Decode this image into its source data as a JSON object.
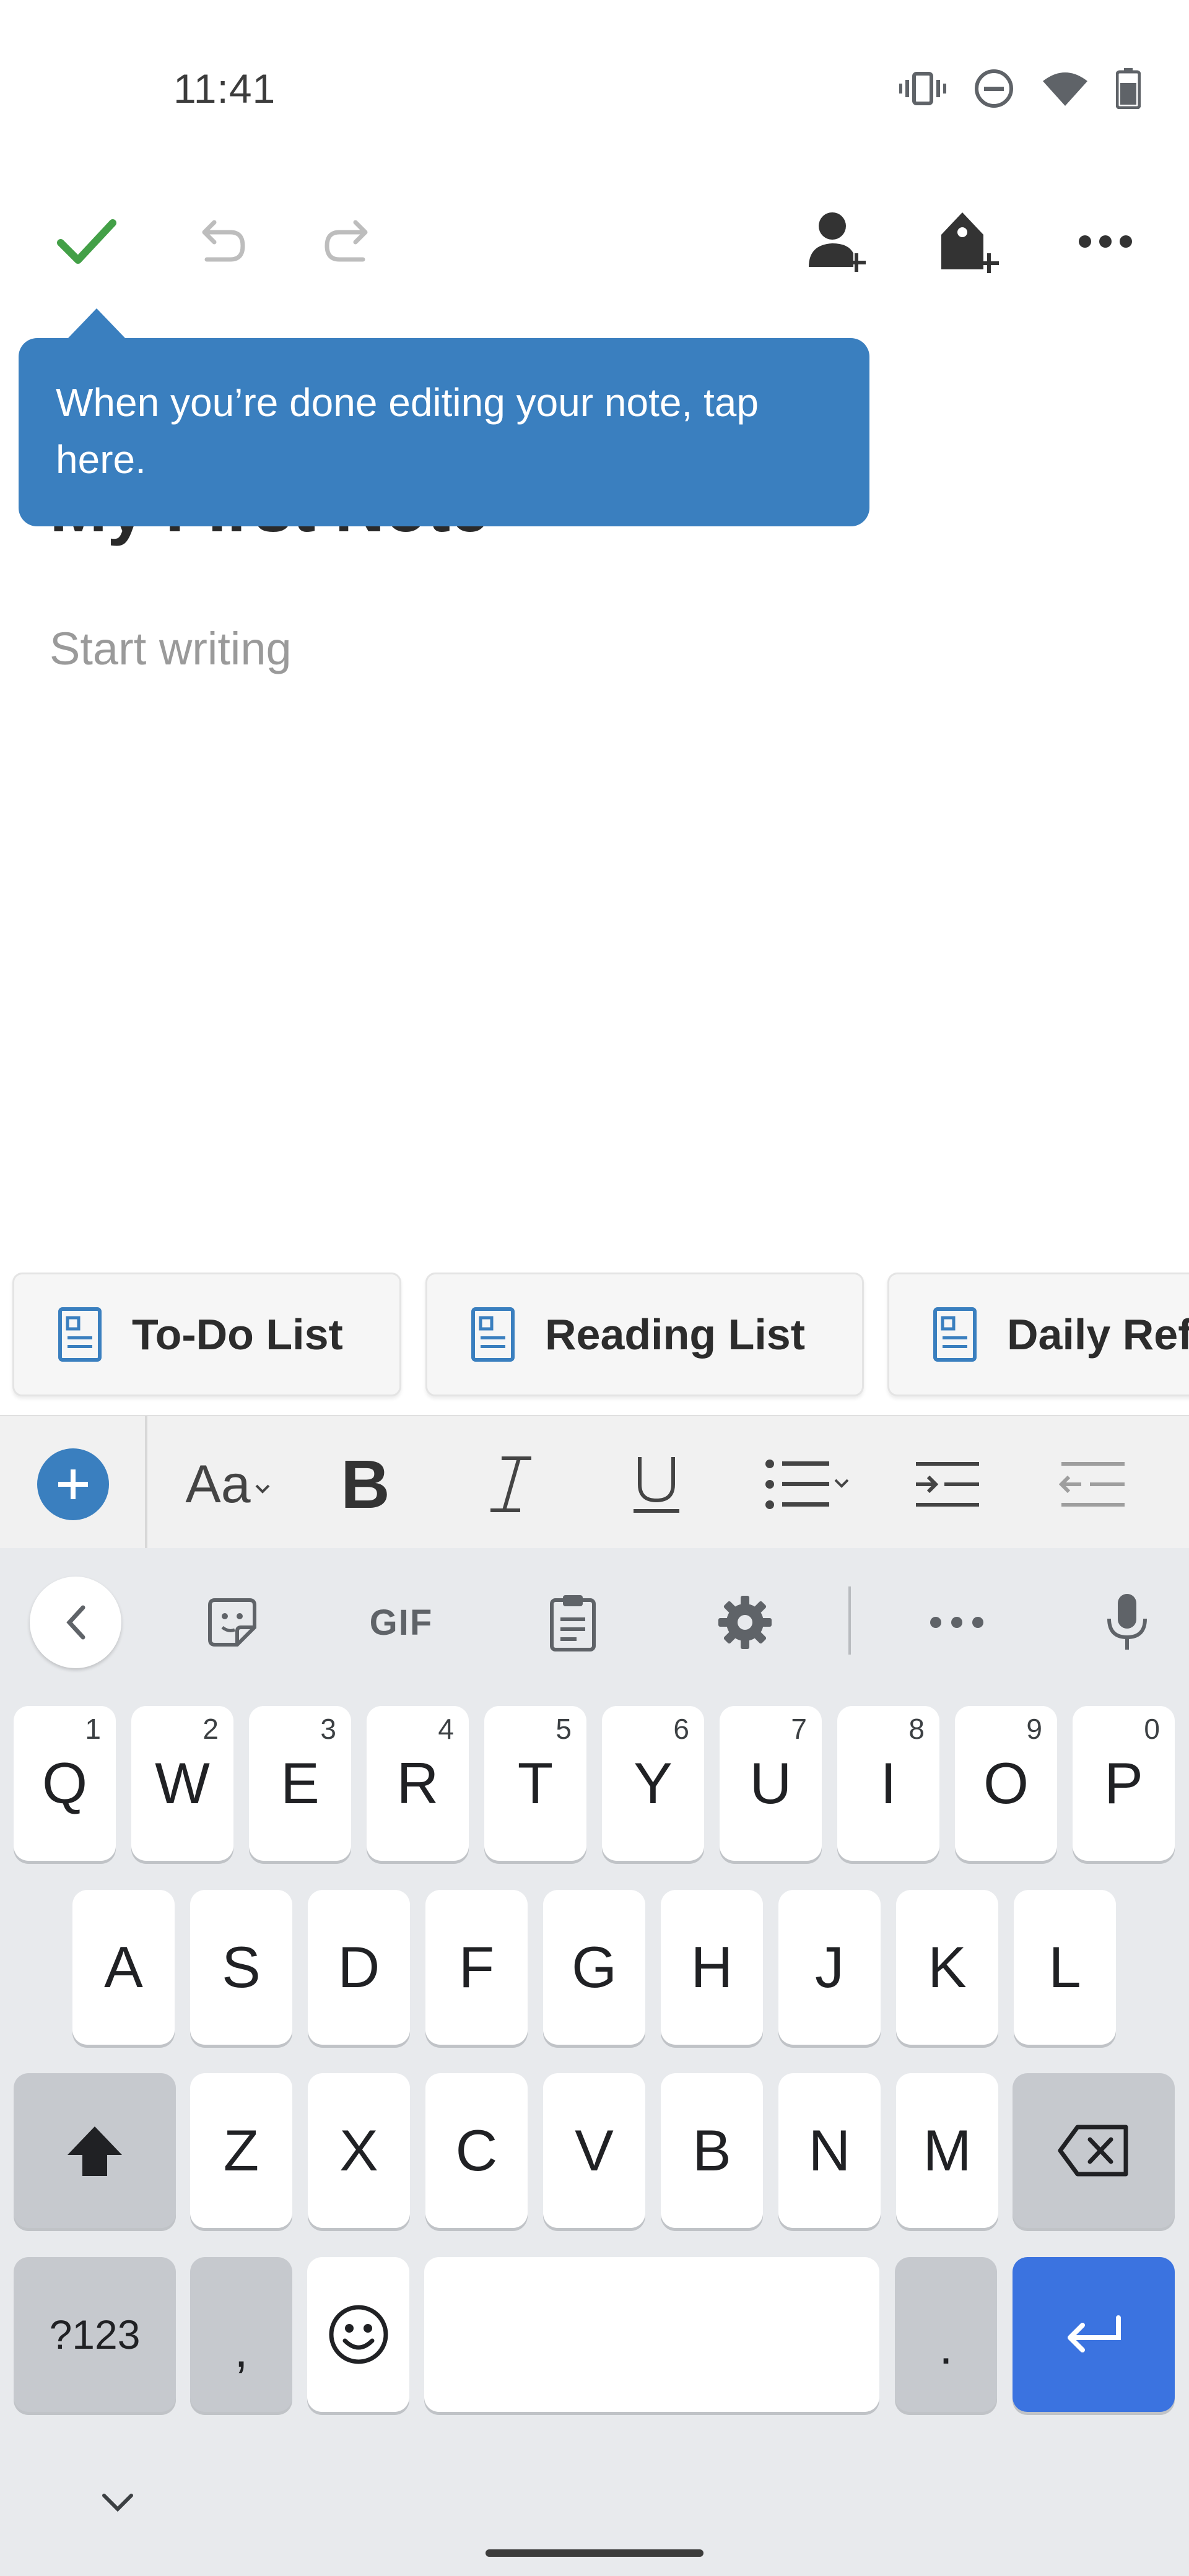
{
  "status_bar": {
    "time": "11:41",
    "icons": [
      "vibrate-icon",
      "do-not-disturb-icon",
      "wifi-icon",
      "battery-icon"
    ]
  },
  "toolbar": {
    "done_icon": "check-icon",
    "undo_icon": "undo-icon",
    "redo_icon": "redo-icon",
    "share_icon": "add-person-icon",
    "tag_icon": "add-tag-icon",
    "more_icon": "more-horizontal-icon"
  },
  "note": {
    "title": "My First Note",
    "body_placeholder": "Start writing"
  },
  "tooltip": {
    "text": "When you’re done editing your note, tap here."
  },
  "templates": [
    {
      "label": "To-Do List",
      "icon": "document-icon"
    },
    {
      "label": "Reading List",
      "icon": "document-icon"
    },
    {
      "label": "Daily Ref",
      "icon": "document-icon"
    }
  ],
  "format_bar": {
    "items": [
      "add-icon",
      "font-size-icon",
      "bold-icon",
      "italic-icon",
      "underline-icon",
      "bullet-list-icon",
      "indent-icon",
      "outdent-icon"
    ],
    "font_label": "Aa"
  },
  "keyboard": {
    "toolbar": {
      "gif_label": "GIF"
    },
    "row1": [
      {
        "key": "Q",
        "hint": "1"
      },
      {
        "key": "W",
        "hint": "2"
      },
      {
        "key": "E",
        "hint": "3"
      },
      {
        "key": "R",
        "hint": "4"
      },
      {
        "key": "T",
        "hint": "5"
      },
      {
        "key": "Y",
        "hint": "6"
      },
      {
        "key": "U",
        "hint": "7"
      },
      {
        "key": "I",
        "hint": "8"
      },
      {
        "key": "O",
        "hint": "9"
      },
      {
        "key": "P",
        "hint": "0"
      }
    ],
    "row2": [
      "A",
      "S",
      "D",
      "F",
      "G",
      "H",
      "J",
      "K",
      "L"
    ],
    "row3": [
      "Z",
      "X",
      "C",
      "V",
      "B",
      "N",
      "M"
    ],
    "bottom": {
      "symbols": "?123",
      "comma": ",",
      "period": "."
    }
  },
  "colors": {
    "accent_blue": "#3a7fbf",
    "check_green": "#43a047",
    "enter_blue": "#3b73e0",
    "keyboard_bg": "#e8eaed"
  }
}
